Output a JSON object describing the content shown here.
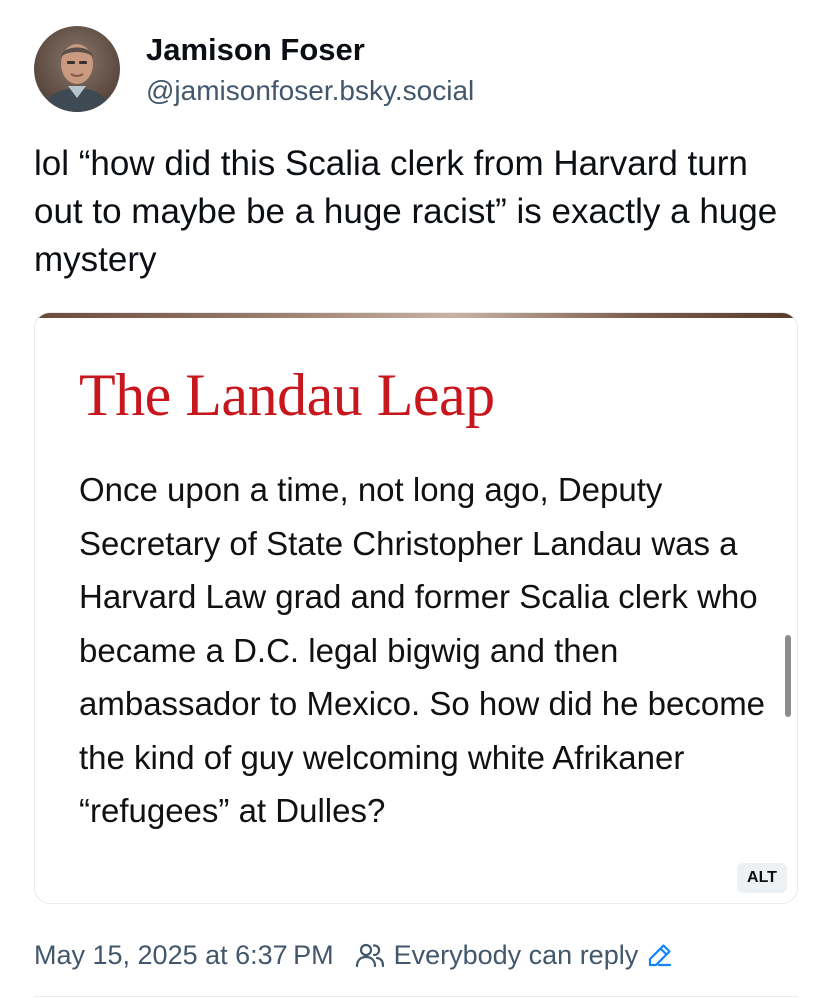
{
  "author": {
    "display_name": "Jamison Foser",
    "handle": "@jamisonfoser.bsky.social"
  },
  "post": {
    "text": "lol “how did this Scalia clerk from Harvard turn out to maybe be a huge racist” is exactly a huge mystery"
  },
  "embed": {
    "title": "The Landau Leap",
    "body": "Once upon a time, not long ago, Deputy Secretary of State Christopher Landau was a Harvard Law grad and former Scalia clerk who became a D.C. legal bigwig and then ambassador to Mexico. So how did he become the kind of guy welcoming white Afrikaner “refugees” at Dulles?",
    "alt_label": "ALT"
  },
  "footer": {
    "timestamp": "May 15, 2025 at 6:37 PM",
    "reply_setting": "Everybody can reply"
  },
  "icons": {
    "reply_setting": "people-icon",
    "edit": "pencil-icon"
  },
  "colors": {
    "title_red": "#c8161d",
    "secondary_text": "#42576c",
    "link_blue": "#1083fe"
  }
}
